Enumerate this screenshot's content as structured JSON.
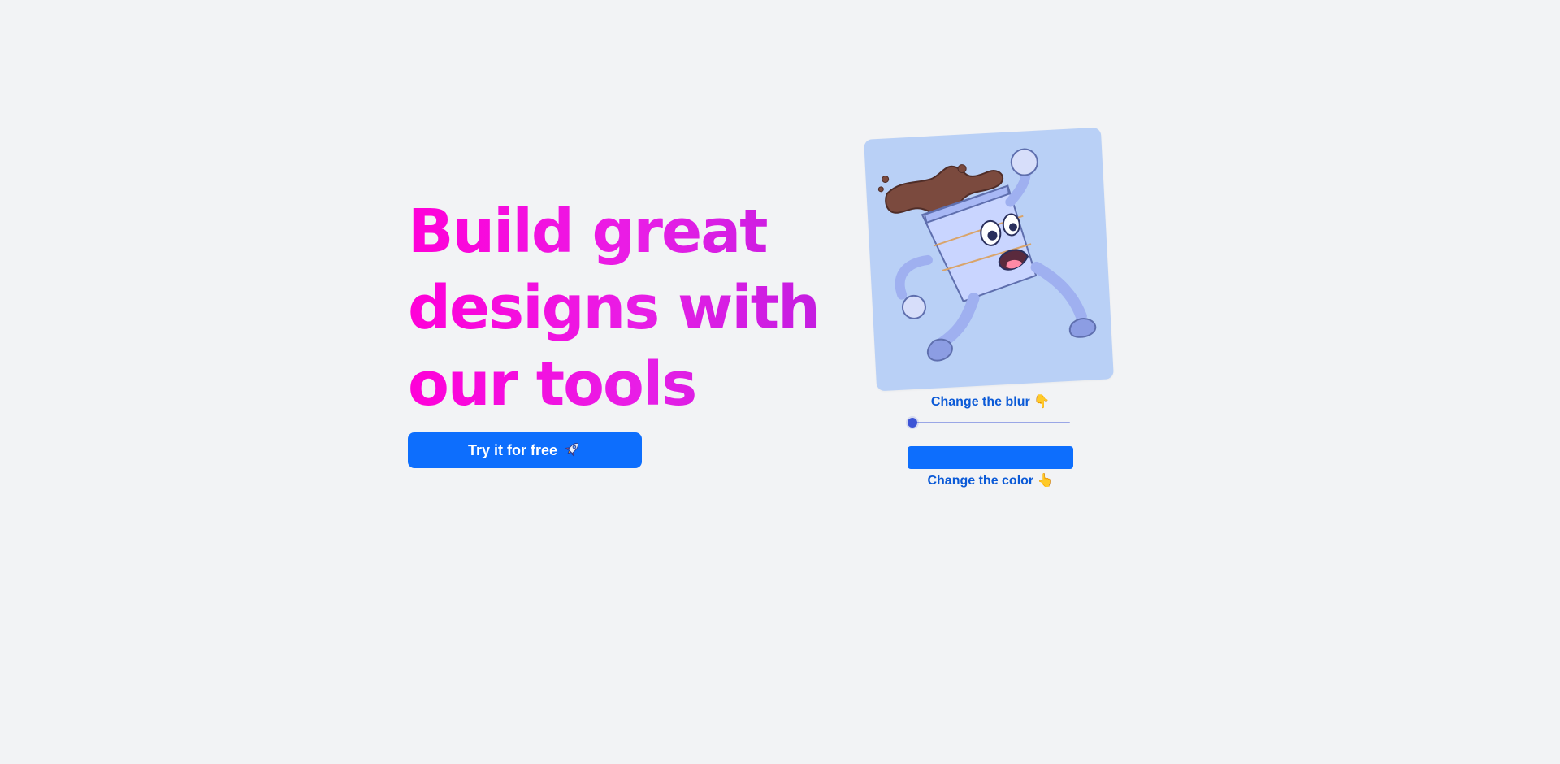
{
  "hero": {
    "title_lines": [
      "Build great",
      "designs with",
      "our tools"
    ],
    "cta_label": "Try it for free",
    "cta_icon": "rocket"
  },
  "tool": {
    "illustration": "coffee-cup-character",
    "blur_label": "Change the blur",
    "blur_icon": "pointing-hand-down",
    "blur_value_fraction": 0,
    "color_label": "Change the color",
    "color_icon": "pointing-hand-up",
    "selected_color": "#0d6efd"
  },
  "colors": {
    "background": "#f2f3f5",
    "title_pink": "#ff00d8",
    "title_purple": "#c21de0",
    "primary_blue": "#0d6efd",
    "card_blue": "#b9d0f6",
    "label_blue": "#0b5ad7",
    "slider_thumb": "#3d54d6"
  }
}
